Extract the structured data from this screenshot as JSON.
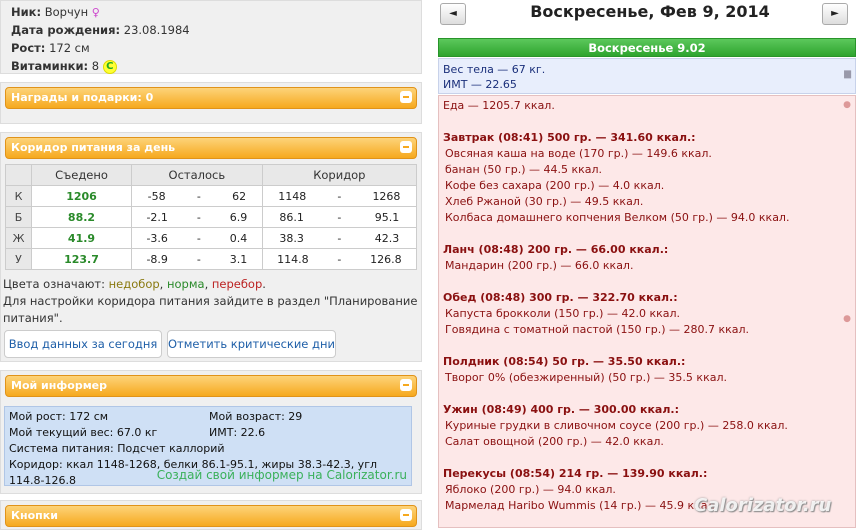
{
  "profile": {
    "nick_label": "Ник:",
    "nick_value": "Ворчун",
    "gender_icon": "venus-icon",
    "birth_label": "Дата рождения:",
    "birth_value": "23.08.1984",
    "height_label": "Рост:",
    "height_value": "172 см",
    "vitamins_label": "Витаминки:",
    "vitamins_value": "8",
    "vitamin_badge": "C"
  },
  "awards": {
    "title": "Награды и подарки: 0"
  },
  "corridor": {
    "title": "Коридор питания за день",
    "headers": [
      "Съедено",
      "Осталось",
      "Коридор"
    ],
    "rows": [
      {
        "label": "К",
        "eaten": "1206",
        "left_min": "-58",
        "left_max": "62",
        "cor_min": "1148",
        "cor_max": "1268"
      },
      {
        "label": "Б",
        "eaten": "88.2",
        "left_min": "-2.1",
        "left_max": "6.9",
        "cor_min": "86.1",
        "cor_max": "95.1"
      },
      {
        "label": "Ж",
        "eaten": "41.9",
        "left_min": "-3.6",
        "left_max": "0.4",
        "cor_min": "38.3",
        "cor_max": "42.3"
      },
      {
        "label": "У",
        "eaten": "123.7",
        "left_min": "-8.9",
        "left_max": "3.1",
        "cor_min": "114.8",
        "cor_max": "126.8"
      }
    ],
    "dash": "-",
    "colors_label": "Цвета означают:",
    "under": "недобор",
    "norm": "норма",
    "over": "перебор",
    "note_line1": "Для настройки коридора питания зайдите в раздел \"Планирование",
    "note_line2": "питания\".",
    "btn_input": "Ввод данных за сегодня",
    "btn_critical": "Отметить критические дни"
  },
  "informer": {
    "title": "Мой информер",
    "height": "Мой рост: 172 см",
    "age": "Мой возраст: 29",
    "weight": "Мой текущий вес: 67.0 кг",
    "bmi": "ИМТ: 22.6",
    "system": "Система питания: Подсчет каллорий",
    "corridor": "Коридор: ккал 1148-1268, белки 86.1-95.1, жиры 38.3-42.3, угл 114.8-126.8",
    "link": "Создай свой информер на Calorizator.ru"
  },
  "buttons_panel": {
    "title": "Кнопки"
  },
  "diary": {
    "prev": "◄",
    "next": "►",
    "date_title": "Воскресенье, Фев 9, 2014",
    "day_bar": "Воскресенье 9.02",
    "weight": "Вес тела — 67 кг.",
    "bmi": "ИМТ — 22.65",
    "food_total": "Еда — 1205.7 ккал.",
    "meals": [
      {
        "title": "Завтрак (08:41) 500 гр. — 341.60 ккал.:",
        "items": [
          "Овсяная каша на воде (170 гр.) — 149.6 ккал.",
          "банан (50 гр.) — 44.5 ккал.",
          "Кофе без сахара (200 гр.) — 4.0 ккал.",
          "Хлеб Ржаной (30 гр.) — 49.5 ккал.",
          "Колбаса домашнего копчения Велком (50 гр.) — 94.0 ккал."
        ]
      },
      {
        "title": "Ланч (08:48) 200 гр. — 66.00 ккал.:",
        "items": [
          "Мандарин (200 гр.) — 66.0 ккал."
        ]
      },
      {
        "title": "Обед (08:48) 300 гр. — 322.70 ккал.:",
        "items": [
          "Капуста брокколи (150 гр.) — 42.0 ккал.",
          "Говядина с томатной пастой (150 гр.) — 280.7 ккал."
        ]
      },
      {
        "title": "Полдник (08:54) 50 гр. — 35.50 ккал.:",
        "items": [
          "Творог 0% (обезжиренный) (50 гр.) — 35.5 ккал."
        ]
      },
      {
        "title": "Ужин (08:49) 400 гр. — 300.00 ккал.:",
        "items": [
          "Куриные грудки в сливочном соусе (200 гр.) — 258.0 ккал.",
          "Салат овощной (200 гр.) — 42.0 ккал."
        ]
      },
      {
        "title": "Перекусы (08:54) 214 гр. — 139.90 ккал.:",
        "items": [
          "Яблоко (200 гр.) — 94.0 ккал.",
          "Мармелад Haribo Wummis (14 гр.) — 45.9 ккал."
        ]
      }
    ],
    "watermark": "Calorizator.ru"
  },
  "colors": {
    "green": "#2ea42e",
    "orange": "#f6a91e",
    "food_bg": "#fde8e8",
    "link": "#1f5fa8"
  }
}
